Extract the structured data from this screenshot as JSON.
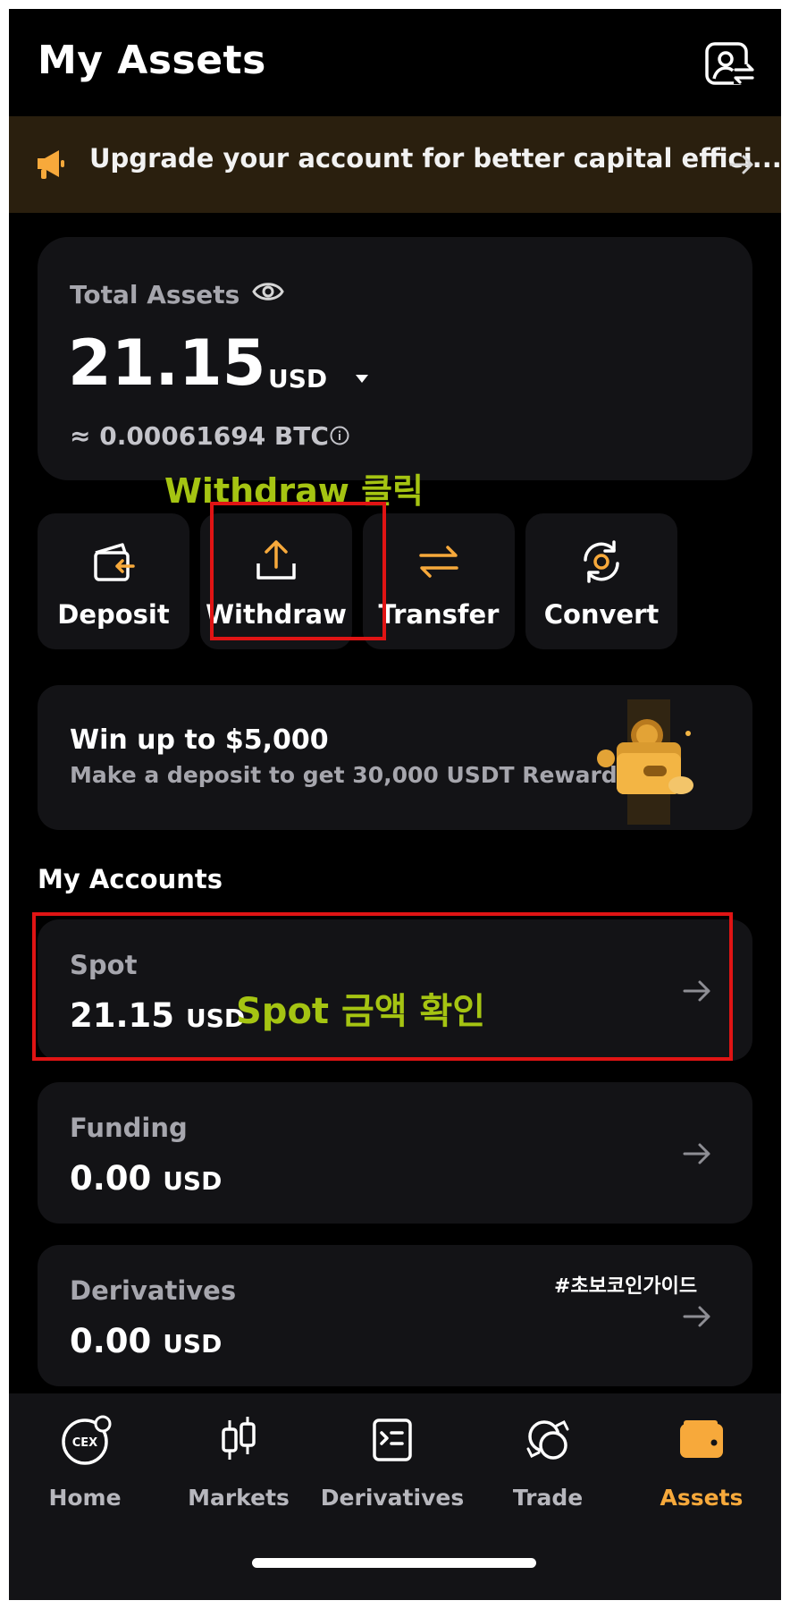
{
  "header": {
    "title": "My Assets"
  },
  "banner": {
    "text": "Upgrade your account for better capital effici..."
  },
  "total_assets": {
    "label": "Total Assets",
    "amount": "21.15",
    "currency": "USD",
    "btc_equivalent": "≈ 0.00061694 BTC"
  },
  "annotations": {
    "withdraw_hint": "Withdraw 클릭",
    "spot_hint": "Spot 금액 확인",
    "watermark": "#초보코인가이드"
  },
  "actions": [
    {
      "label": "Deposit",
      "icon": "deposit-icon"
    },
    {
      "label": "Withdraw",
      "icon": "withdraw-icon"
    },
    {
      "label": "Transfer",
      "icon": "transfer-icon"
    },
    {
      "label": "Convert",
      "icon": "convert-icon"
    }
  ],
  "promo": {
    "headline": "Win up to $5,000",
    "subtitle": "Make a deposit to get 30,000 USDT Rewards"
  },
  "accounts": {
    "section_title": "My Accounts",
    "items": [
      {
        "name": "Spot",
        "amount": "21.15",
        "currency": "USD"
      },
      {
        "name": "Funding",
        "amount": "0.00",
        "currency": "USD"
      },
      {
        "name": "Derivatives",
        "amount": "0.00",
        "currency": "USD"
      }
    ]
  },
  "nav": {
    "items": [
      {
        "label": "Home",
        "icon": "cex-home-icon",
        "badge": "CEX"
      },
      {
        "label": "Markets",
        "icon": "candlestick-icon"
      },
      {
        "label": "Derivatives",
        "icon": "terminal-doc-icon"
      },
      {
        "label": "Trade",
        "icon": "trade-swap-icon"
      },
      {
        "label": "Assets",
        "icon": "wallet-icon"
      }
    ],
    "active": "Assets"
  },
  "colors": {
    "accent": "#f7a93b",
    "annotation": "#a5c412",
    "highlight_box": "#e01414",
    "card_bg": "#131316",
    "banner_bg": "#2a1f0e"
  }
}
